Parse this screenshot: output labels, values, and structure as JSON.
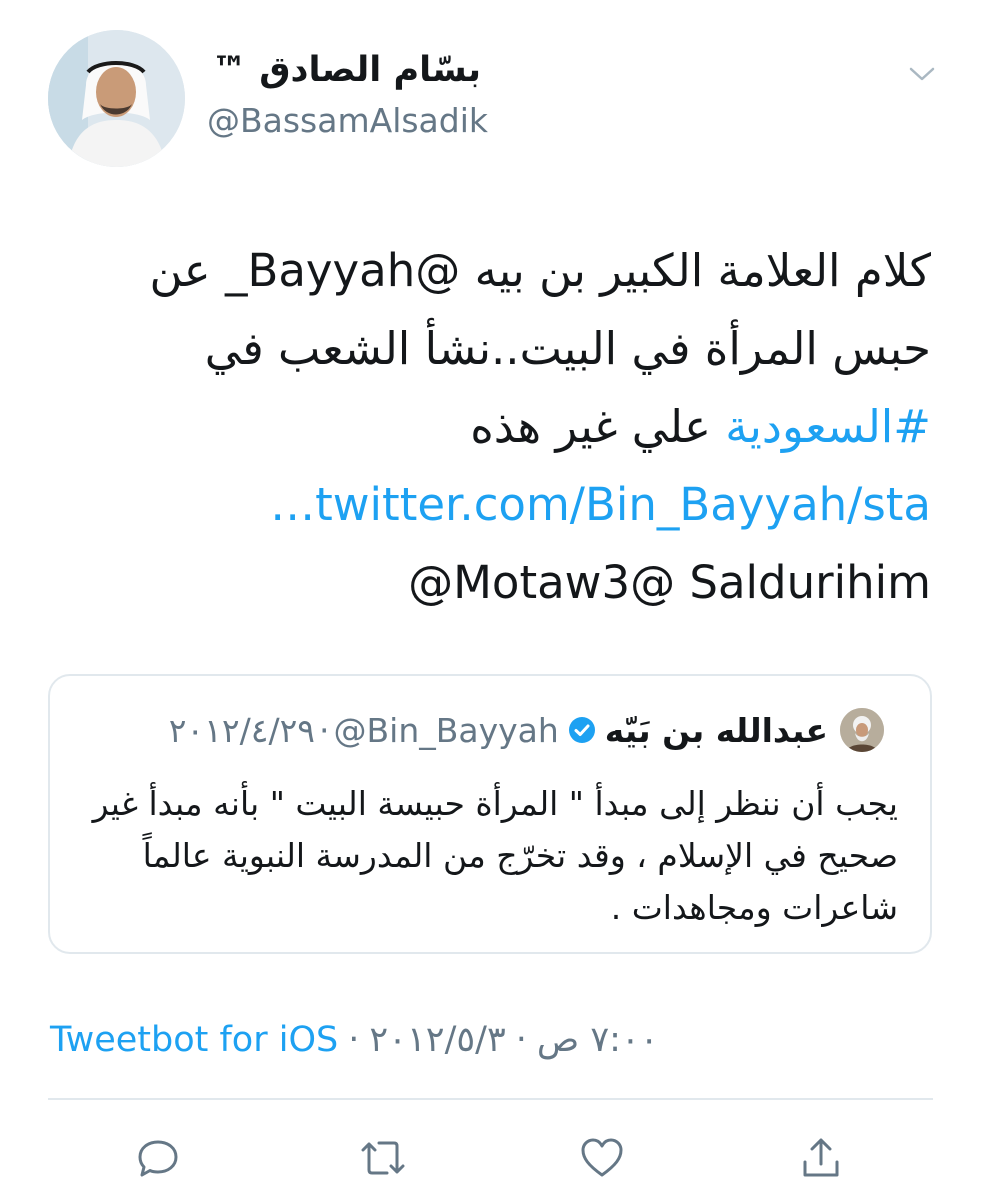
{
  "author": {
    "display_name": "بسّام الصادق ™",
    "handle": "@BassamAlsadik"
  },
  "icons": {
    "menu": "chevron-down-icon",
    "verified": "verified-badge-icon",
    "reply": "reply-icon",
    "retweet": "retweet-icon",
    "like": "heart-icon",
    "share": "share-icon"
  },
  "tweet": {
    "line1": "كلام العلامة الكبير بن بيه @Bayyah_ عن",
    "line2": "حبس المرأة في البيت..نشأ الشعب في",
    "line3_hashtag": "#السعودية",
    "line3_text": " علي غير هذه",
    "link": "twitter.com/Bin_Bayyah/sta…",
    "mentions": "Motaw3@ Saldurihim@"
  },
  "quoted_tweet": {
    "display_name": "عبدالله بن بَيّه",
    "handle": "@Bin_Bayyah",
    "separator": "·",
    "date": "٢٠١٢/٤/٢٩",
    "text": "يجب أن ننظر إلى مبدأ \" المرأة حبيسة البيت \" بأنه مبدأ غير صحيح في الإسلام ، وقد تخرّج من المدرسة النبوية عالماً شاعرات ومجاهدات ."
  },
  "meta": {
    "time": "٧:٠٠ ص",
    "date": "٢٠١٢/٥/٣",
    "separator": "·",
    "source": "Tweetbot for iOS"
  },
  "colors": {
    "link": "#1da1f2",
    "secondary_text": "#657786",
    "border": "#e1e8ed",
    "primary_text": "#14171a"
  }
}
